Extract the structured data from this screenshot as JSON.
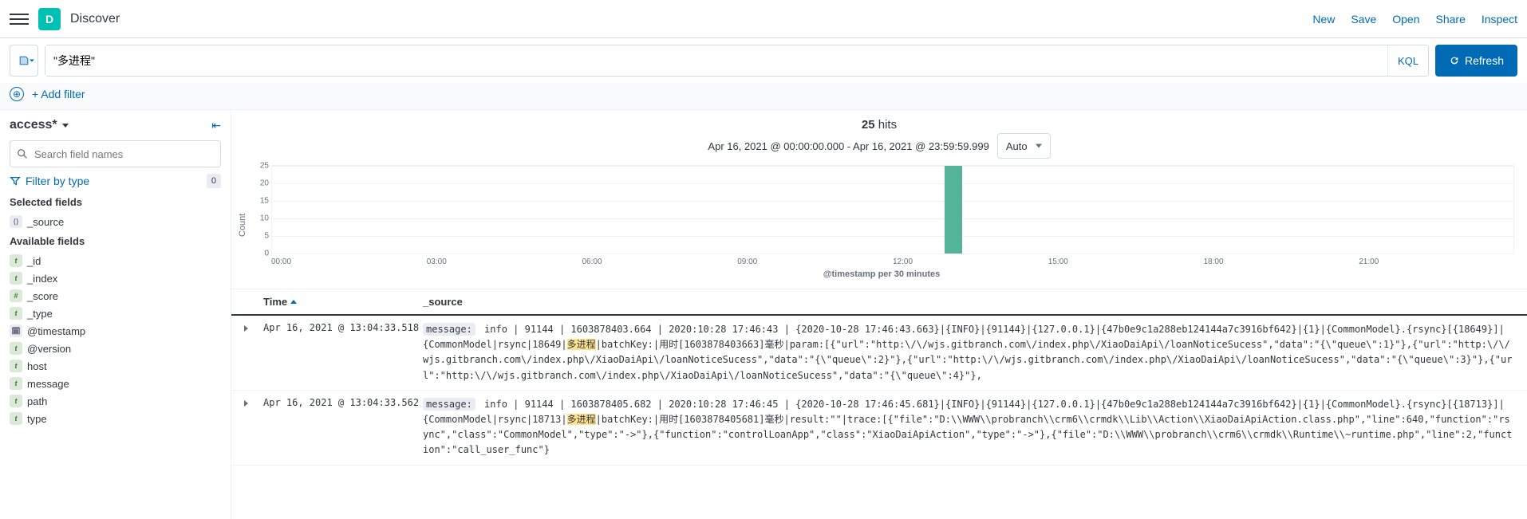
{
  "header": {
    "logo_letter": "D",
    "title": "Discover",
    "links": [
      "New",
      "Save",
      "Open",
      "Share",
      "Inspect"
    ]
  },
  "query": {
    "value": "\"多进程\"",
    "language_label": "KQL",
    "refresh_label": "Refresh"
  },
  "filters": {
    "add_filter_label": "+ Add filter"
  },
  "sidebar": {
    "index_pattern": "access*",
    "search_placeholder": "Search field names",
    "filter_by_type_label": "Filter by type",
    "filter_by_type_count": "0",
    "selected_fields_title": "Selected fields",
    "available_fields_title": "Available fields",
    "selected_fields": [
      {
        "name": "_source",
        "type": "s"
      }
    ],
    "available_fields": [
      {
        "name": "_id",
        "type": "t"
      },
      {
        "name": "_index",
        "type": "t"
      },
      {
        "name": "_score",
        "type": "h"
      },
      {
        "name": "_type",
        "type": "t"
      },
      {
        "name": "@timestamp",
        "type": "d"
      },
      {
        "name": "@version",
        "type": "t"
      },
      {
        "name": "host",
        "type": "t"
      },
      {
        "name": "message",
        "type": "t"
      },
      {
        "name": "path",
        "type": "t"
      },
      {
        "name": "type",
        "type": "t"
      }
    ]
  },
  "results": {
    "hit_count": "25",
    "hits_label": "hits",
    "time_range": "Apr 16, 2021 @ 00:00:00.000 - Apr 16, 2021 @ 23:59:59.999",
    "interval_selected": "Auto",
    "chart": {
      "y_label": "Count",
      "x_label": "@timestamp per 30 minutes"
    },
    "columns": {
      "time": "Time",
      "source": "_source"
    },
    "rows": [
      {
        "time": "Apr 16, 2021 @ 13:04:33.518",
        "source_field": "message:",
        "source_pre": "info | 91144 | 1603878403.664 | 2020:10:28 17:46:43 | {2020-10-28 17:46:43.663}|{INFO}|{91144}|{127.0.0.1}|{47b0e9c1a288eb124144a7c3916bf642}|{1}|{CommonModel}.{rsync}[{18649}]|{CommonModel|rsync|18649|",
        "source_hl": "多进程",
        "source_post": "|batchKey:|用时[1603878403663]毫秒|param:[{\"url\":\"http:\\/\\/wjs.gitbranch.com\\/index.php\\/XiaoDaiApi\\/loanNoticeSucess\",\"data\":\"{\\\"queue\\\":1}\"},{\"url\":\"http:\\/\\/wjs.gitbranch.com\\/index.php\\/XiaoDaiApi\\/loanNoticeSucess\",\"data\":\"{\\\"queue\\\":2}\"},{\"url\":\"http:\\/\\/wjs.gitbranch.com\\/index.php\\/XiaoDaiApi\\/loanNoticeSucess\",\"data\":\"{\\\"queue\\\":3}\"},{\"url\":\"http:\\/\\/wjs.gitbranch.com\\/index.php\\/XiaoDaiApi\\/loanNoticeSucess\",\"data\":\"{\\\"queue\\\":4}\"},"
      },
      {
        "time": "Apr 16, 2021 @ 13:04:33.562",
        "source_field": "message:",
        "source_pre": "info | 91144 | 1603878405.682 | 2020:10:28 17:46:45 | {2020-10-28 17:46:45.681}|{INFO}|{91144}|{127.0.0.1}|{47b0e9c1a288eb124144a7c3916bf642}|{1}|{CommonModel}.{rsync}[{18713}]|{CommonModel|rsync|18713|",
        "source_hl": "多进程",
        "source_post": "|batchKey:|用时[1603878405681]毫秒|result:\"\"|trace:[{\"file\":\"D:\\\\WWW\\\\probranch\\\\crm6\\\\crmdk\\\\Lib\\\\Action\\\\XiaoDaiApiAction.class.php\",\"line\":640,\"function\":\"rsync\",\"class\":\"CommonModel\",\"type\":\"->\"},{\"function\":\"controlLoanApp\",\"class\":\"XiaoDaiApiAction\",\"type\":\"->\"},{\"file\":\"D:\\\\WWW\\\\probranch\\\\crm6\\\\crmdk\\\\Runtime\\\\~runtime.php\",\"line\":2,\"function\":\"call_user_func\"}"
      }
    ]
  },
  "chart_data": {
    "type": "bar",
    "title": "",
    "xlabel": "@timestamp per 30 minutes",
    "ylabel": "Count",
    "ylim": [
      0,
      25
    ],
    "yticks": [
      0,
      5,
      10,
      15,
      20,
      25
    ],
    "xticks": [
      "00:00",
      "03:00",
      "06:00",
      "09:00",
      "12:00",
      "15:00",
      "18:00",
      "21:00"
    ],
    "x_range_minutes": [
      0,
      1440
    ],
    "bucket_minutes": 30,
    "series": [
      {
        "name": "Count",
        "points": [
          {
            "x_minute": 780,
            "value": 25
          }
        ]
      }
    ]
  }
}
